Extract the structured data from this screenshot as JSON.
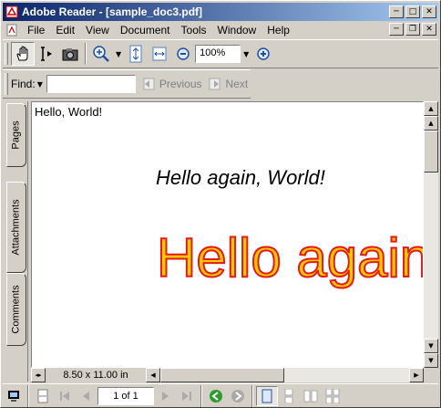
{
  "window": {
    "title": "Adobe Reader - [sample_doc3.pdf]"
  },
  "menu": [
    {
      "label": "File"
    },
    {
      "label": "Edit"
    },
    {
      "label": "View"
    },
    {
      "label": "Document"
    },
    {
      "label": "Tools"
    },
    {
      "label": "Window"
    },
    {
      "label": "Help"
    }
  ],
  "toolbar": {
    "tools": [
      "hand-tool-icon",
      "select-text-icon",
      "snapshot-icon",
      "zoom-in-tool-icon",
      "actual-size-icon",
      "fit-width-icon",
      "zoom-out-icon",
      "zoom-in-icon"
    ],
    "zoom_value": "100%"
  },
  "find": {
    "label": "Find:",
    "value": "",
    "previous_label": "Previous",
    "next_label": "Next"
  },
  "sidebar": {
    "tabs": [
      "Pages",
      "Attachments",
      "Comments"
    ]
  },
  "document": {
    "line1": "Hello, World!",
    "line2": "Hello again, World!",
    "line3": "Hello again",
    "line3_fill": "#ffc800",
    "line3_stroke": "#e21a1a"
  },
  "status": {
    "page_size": "8.50 x 11.00 in",
    "page_indicator": "1 of 1"
  },
  "colors": {
    "titlebar_start": "#0a246a",
    "titlebar_end": "#a6caf0",
    "chrome": "#d4d0c8",
    "nav_green": "#2f9a2f"
  }
}
